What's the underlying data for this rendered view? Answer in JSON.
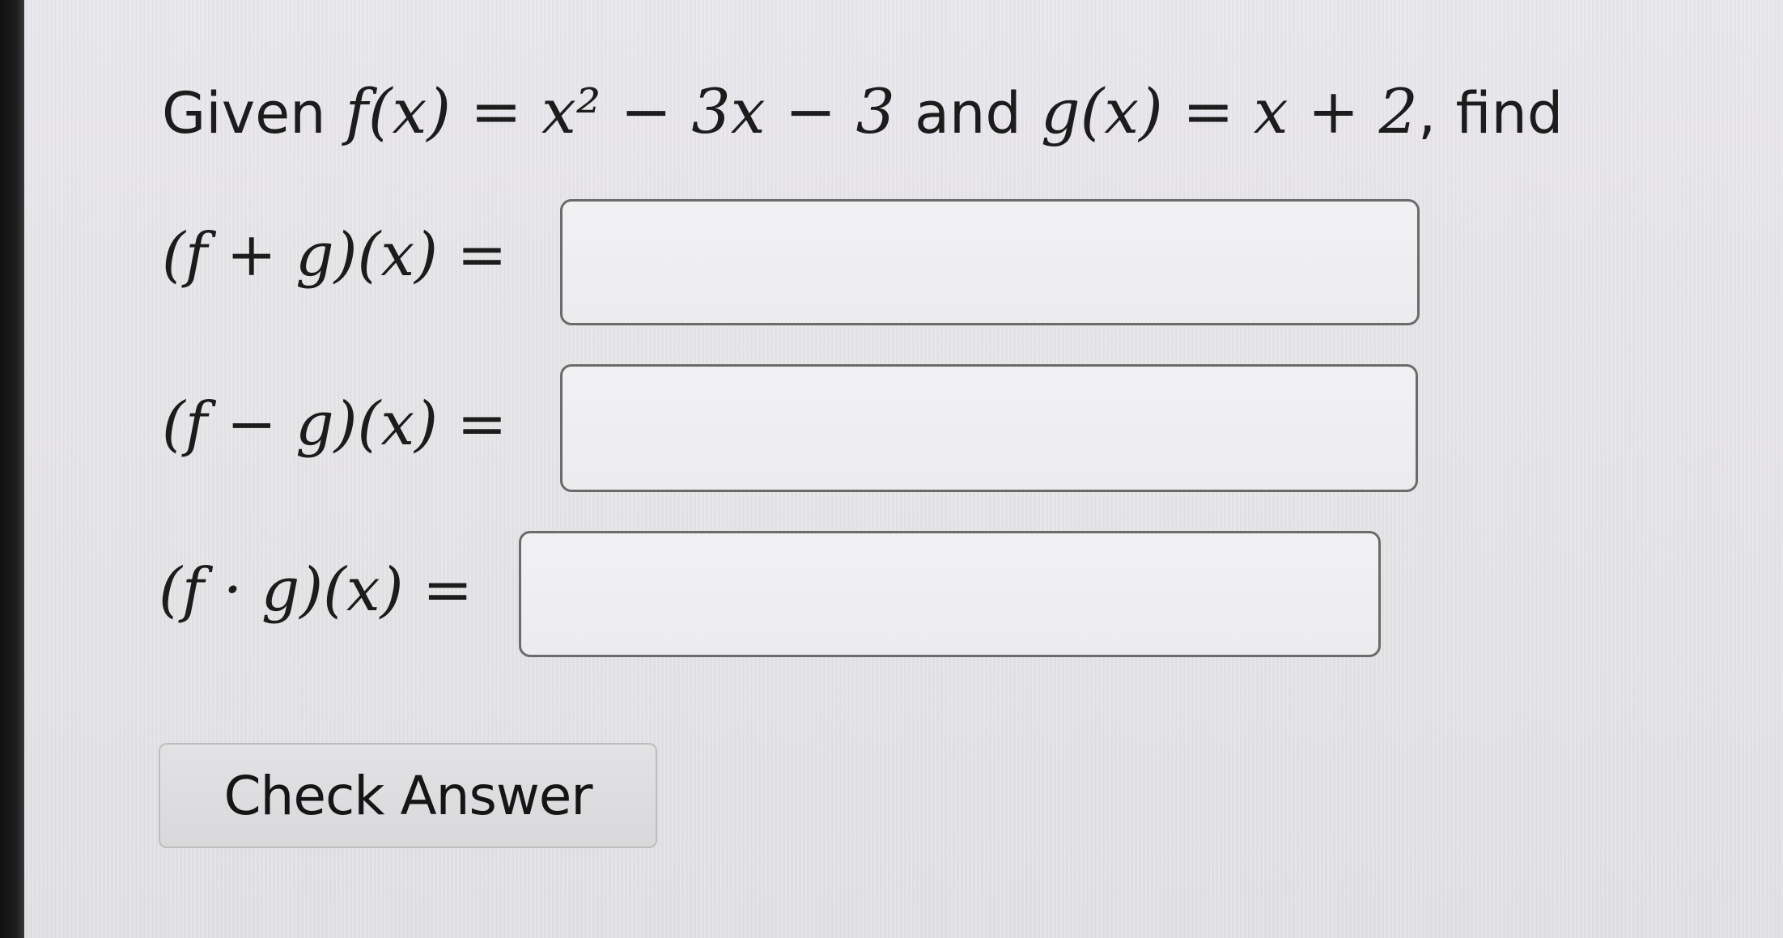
{
  "problem": {
    "given_word": "Given",
    "and_word": "and",
    "find_word": "find",
    "f_def": "f(x) = x² − 3x − 3",
    "g_def": "g(x) = x + 2"
  },
  "rows": [
    {
      "label": "(f + g)(x) =",
      "value": ""
    },
    {
      "label": "(f − g)(x) =",
      "value": ""
    },
    {
      "label": "(f · g)(x) =",
      "value": ""
    }
  ],
  "check_button": {
    "label": "Check Answer"
  }
}
